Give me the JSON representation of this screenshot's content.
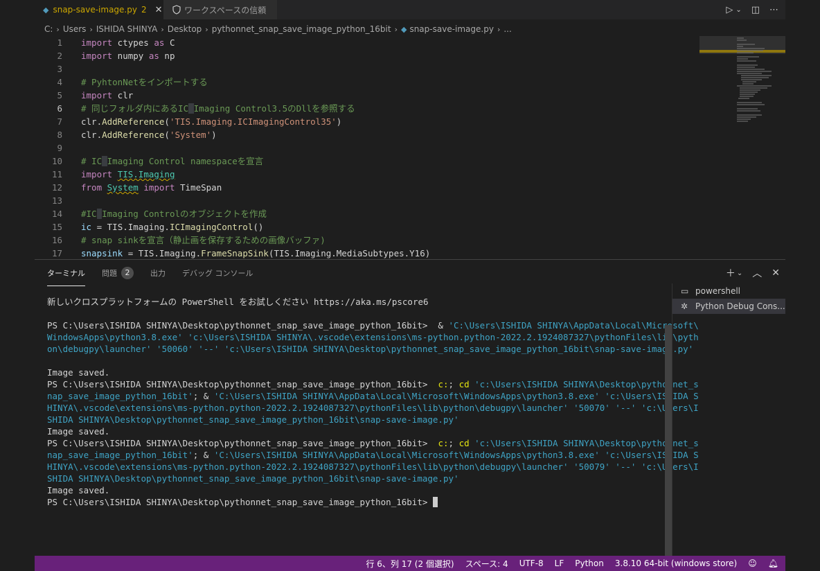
{
  "tabs": [
    {
      "label": "snap-save-image.py",
      "badge": "2"
    },
    {
      "label": "ワークスペースの信頼"
    }
  ],
  "breadcrumb": [
    "C:",
    "Users",
    "ISHIDA SHINYA",
    "Desktop",
    "pythonnet_snap_save_image_python_16bit",
    "snap-save-image.py",
    "..."
  ],
  "editor": {
    "active_line": 6,
    "line_numbers": [
      "1",
      "2",
      "3",
      "4",
      "5",
      "6",
      "7",
      "8",
      "9",
      "10",
      "11",
      "12",
      "13",
      "14",
      "15",
      "16",
      "17"
    ],
    "lines": [
      [
        {
          "t": "import",
          "c": "kw2"
        },
        {
          "t": " ctypes ",
          "c": "pl"
        },
        {
          "t": "as",
          "c": "kw2"
        },
        {
          "t": " C",
          "c": "pl"
        }
      ],
      [
        {
          "t": "import",
          "c": "kw2"
        },
        {
          "t": " numpy ",
          "c": "pl"
        },
        {
          "t": "as",
          "c": "kw2"
        },
        {
          "t": " np",
          "c": "pl"
        }
      ],
      [],
      [
        {
          "t": "# PyhtonNetをインポートする",
          "c": "cm"
        }
      ],
      [
        {
          "t": "import",
          "c": "kw2"
        },
        {
          "t": " clr",
          "c": "pl"
        }
      ],
      [
        {
          "t": "# 同じフォルダ内にあるIC",
          "c": "cm"
        },
        {
          "t": " ",
          "c": "cm hl"
        },
        {
          "t": "Imaging Control3.5のDllを参照する",
          "c": "cm"
        }
      ],
      [
        {
          "t": "clr.",
          "c": "pl"
        },
        {
          "t": "AddReference",
          "c": "fn"
        },
        {
          "t": "(",
          "c": "pl"
        },
        {
          "t": "'TIS.Imaging.ICImagingControl35'",
          "c": "str"
        },
        {
          "t": ")",
          "c": "pl"
        }
      ],
      [
        {
          "t": "clr.",
          "c": "pl"
        },
        {
          "t": "AddReference",
          "c": "fn"
        },
        {
          "t": "(",
          "c": "pl"
        },
        {
          "t": "'System'",
          "c": "str"
        },
        {
          "t": ")",
          "c": "pl"
        }
      ],
      [],
      [
        {
          "t": "# IC",
          "c": "cm"
        },
        {
          "t": " ",
          "c": "cm hl"
        },
        {
          "t": "Imaging Control namespaceを宣言",
          "c": "cm"
        }
      ],
      [
        {
          "t": "import",
          "c": "kw2"
        },
        {
          "t": " ",
          "c": "pl"
        },
        {
          "t": "TIS.Imaging",
          "c": "cls squig"
        }
      ],
      [
        {
          "t": "from",
          "c": "kw2"
        },
        {
          "t": " ",
          "c": "pl"
        },
        {
          "t": "System",
          "c": "cls squig"
        },
        {
          "t": " ",
          "c": "pl"
        },
        {
          "t": "import",
          "c": "kw2"
        },
        {
          "t": " TimeSpan",
          "c": "pl"
        }
      ],
      [],
      [
        {
          "t": "#IC",
          "c": "cm"
        },
        {
          "t": " ",
          "c": "cm hl"
        },
        {
          "t": "Imaging Controlのオブジェクトを作成",
          "c": "cm"
        }
      ],
      [
        {
          "t": "ic",
          "c": "var"
        },
        {
          "t": " = TIS.Imaging.",
          "c": "pl"
        },
        {
          "t": "ICImagingControl",
          "c": "fn"
        },
        {
          "t": "()",
          "c": "pl"
        }
      ],
      [
        {
          "t": "# snap sinkを宣言（静止画を保存するための画像バッファ)",
          "c": "cm"
        }
      ],
      [
        {
          "t": "snapsink",
          "c": "var"
        },
        {
          "t": " = TIS.Imaging.",
          "c": "pl"
        },
        {
          "t": "FrameSnapSink",
          "c": "fn"
        },
        {
          "t": "(TIS.Imaging.MediaSubtypes.Y16)",
          "c": "pl"
        }
      ]
    ]
  },
  "panel": {
    "tabs": {
      "terminal": "ターミナル",
      "problems": "問題",
      "problems_count": "2",
      "output": "出力",
      "debug_console": "デバッグ コンソール"
    },
    "terminal_lines": [
      [
        {
          "t": "新しいクロスプラットフォームの PowerShell をお試しください https://aka.ms/pscore6",
          "c": "tcmd"
        }
      ],
      [],
      [
        {
          "t": "PS C:\\Users\\ISHIDA SHINYA\\Desktop\\pythonnet_snap_save_image_python_16bit>  & ",
          "c": "tcmd"
        },
        {
          "t": "'C:\\Users\\ISHIDA SHINYA\\AppData\\Local\\Microsoft\\",
          "c": "tstr"
        }
      ],
      [
        {
          "t": "WindowsApps\\python3.8.exe' 'c:\\Users\\ISHIDA SHINYA\\.vscode\\extensions\\ms-python.python-2022.2.1924087327\\pythonFiles\\lib\\pyth",
          "c": "tstr"
        }
      ],
      [
        {
          "t": "on\\debugpy\\launcher' '50060' '--' 'c:\\Users\\ISHIDA SHINYA\\Desktop\\pythonnet_snap_save_image_python_16bit\\snap-save-image.py'",
          "c": "tstr"
        }
      ],
      [],
      [
        {
          "t": "Image saved.",
          "c": "tcmd"
        }
      ],
      [
        {
          "t": "PS C:\\Users\\ISHIDA SHINYA\\Desktop\\pythonnet_snap_save_image_python_16bit>  ",
          "c": "tcmd"
        },
        {
          "t": "c:",
          "c": "tcyan"
        },
        {
          "t": "; ",
          "c": "tcmd"
        },
        {
          "t": "cd",
          "c": "tcyan"
        },
        {
          "t": " 'c:\\Users\\ISHIDA SHINYA\\Desktop\\pythonnet_s",
          "c": "tstr"
        }
      ],
      [
        {
          "t": "nap_save_image_python_16bit'",
          "c": "tstr"
        },
        {
          "t": "; & ",
          "c": "tcmd"
        },
        {
          "t": "'C:\\Users\\ISHIDA SHINYA\\AppData\\Local\\Microsoft\\WindowsApps\\python3.8.exe' 'c:\\Users\\ISHIDA S",
          "c": "tstr"
        }
      ],
      [
        {
          "t": "HINYA\\.vscode\\extensions\\ms-python.python-2022.2.1924087327\\pythonFiles\\lib\\python\\debugpy\\launcher' '50070' '--' 'c:\\Users\\I",
          "c": "tstr"
        }
      ],
      [
        {
          "t": "SHIDA SHINYA\\Desktop\\pythonnet_snap_save_image_python_16bit\\snap-save-image.py'",
          "c": "tstr"
        }
      ],
      [
        {
          "t": "Image saved.",
          "c": "tcmd"
        }
      ],
      [
        {
          "t": "PS C:\\Users\\ISHIDA SHINYA\\Desktop\\pythonnet_snap_save_image_python_16bit>  ",
          "c": "tcmd"
        },
        {
          "t": "c:",
          "c": "tcyan"
        },
        {
          "t": "; ",
          "c": "tcmd"
        },
        {
          "t": "cd",
          "c": "tcyan"
        },
        {
          "t": " 'c:\\Users\\ISHIDA SHINYA\\Desktop\\pythonnet_s",
          "c": "tstr"
        }
      ],
      [
        {
          "t": "nap_save_image_python_16bit'",
          "c": "tstr"
        },
        {
          "t": "; & ",
          "c": "tcmd"
        },
        {
          "t": "'C:\\Users\\ISHIDA SHINYA\\AppData\\Local\\Microsoft\\WindowsApps\\python3.8.exe' 'c:\\Users\\ISHIDA S",
          "c": "tstr"
        }
      ],
      [
        {
          "t": "HINYA\\.vscode\\extensions\\ms-python.python-2022.2.1924087327\\pythonFiles\\lib\\python\\debugpy\\launcher' '50079' '--' 'c:\\Users\\I",
          "c": "tstr"
        }
      ],
      [
        {
          "t": "SHIDA SHINYA\\Desktop\\pythonnet_snap_save_image_python_16bit\\snap-save-image.py'",
          "c": "tstr"
        }
      ],
      [
        {
          "t": "Image saved.",
          "c": "tcmd"
        }
      ],
      [
        {
          "t": "PS C:\\Users\\ISHIDA SHINYA\\Desktop\\pythonnet_snap_save_image_python_16bit> ",
          "c": "tcmd"
        }
      ]
    ],
    "terminal_list": [
      {
        "label": "powershell",
        "icon": "terminal-icon"
      },
      {
        "label": "Python Debug Cons...",
        "icon": "debug-icon"
      }
    ]
  },
  "statusbar": {
    "position": "行 6、列 17 (2 個選択)",
    "spaces": "スペース: 4",
    "encoding": "UTF-8",
    "eol": "LF",
    "language": "Python",
    "interpreter": "3.8.10 64-bit (windows store)"
  },
  "colors": {
    "statusbar": "#68217a",
    "accent_warning": "#cca700"
  }
}
